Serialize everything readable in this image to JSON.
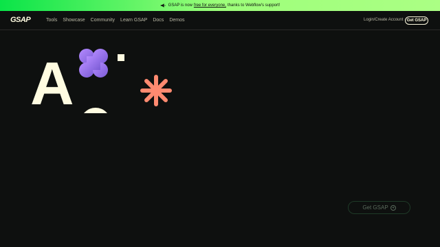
{
  "banner": {
    "icon": "megaphone-icon",
    "text_before": "GSAP is now",
    "link_text": "free for everyone,",
    "text_after": "thanks to Webflow's support!"
  },
  "nav": {
    "logo": "GSAP",
    "items": [
      {
        "label": "Tools"
      },
      {
        "label": "Showcase"
      },
      {
        "label": "Community"
      },
      {
        "label": "Learn GSAP"
      },
      {
        "label": "Docs"
      },
      {
        "label": "Demos"
      }
    ],
    "login": "Login/Create Account",
    "cta": "Get GSAP"
  },
  "hero": {
    "letter": "A",
    "shape_colors": {
      "flower_from": "#b58bff",
      "flower_to": "#7b5cd6",
      "star": "#ff8a70",
      "cream": "#fffce1"
    }
  },
  "cta": {
    "label": "Get GSAP",
    "icon": "arrow-right-icon"
  }
}
